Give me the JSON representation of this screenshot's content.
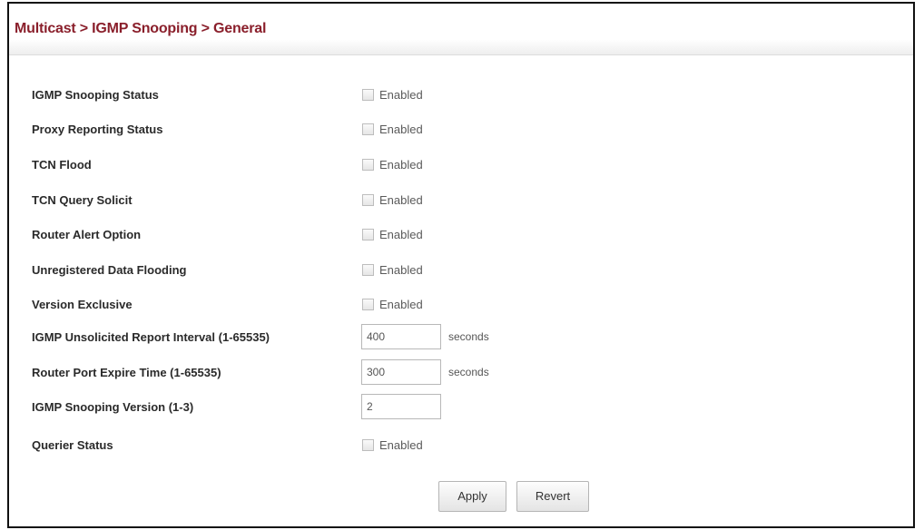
{
  "header": {
    "title": "Multicast > IGMP Snooping > General"
  },
  "form": {
    "rows": [
      {
        "label": "IGMP Snooping Status",
        "control": "checkbox",
        "checkbox_label": "Enabled",
        "checked": false
      },
      {
        "label": "Proxy Reporting Status",
        "control": "checkbox",
        "checkbox_label": "Enabled",
        "checked": false
      },
      {
        "label": "TCN Flood",
        "control": "checkbox",
        "checkbox_label": "Enabled",
        "checked": false
      },
      {
        "label": "TCN Query Solicit",
        "control": "checkbox",
        "checkbox_label": "Enabled",
        "checked": false
      },
      {
        "label": "Router Alert Option",
        "control": "checkbox",
        "checkbox_label": "Enabled",
        "checked": false
      },
      {
        "label": "Unregistered Data Flooding",
        "control": "checkbox",
        "checkbox_label": "Enabled",
        "checked": false
      },
      {
        "label": "Version Exclusive",
        "control": "checkbox",
        "checkbox_label": "Enabled",
        "checked": false
      },
      {
        "label": "IGMP Unsolicited Report Interval (1-65535)",
        "control": "input",
        "value": "400",
        "unit": "seconds"
      },
      {
        "label": "Router Port Expire Time (1-65535)",
        "control": "input",
        "value": "300",
        "unit": "seconds"
      },
      {
        "label": "IGMP Snooping Version (1-3)",
        "control": "input",
        "value": "2",
        "unit": ""
      },
      {
        "label": "Querier Status",
        "control": "checkbox",
        "checkbox_label": "Enabled",
        "checked": false
      }
    ]
  },
  "buttons": {
    "apply_label": "Apply",
    "revert_label": "Revert"
  },
  "colors": {
    "title": "#8a1f2b",
    "label": "#2a2a2a",
    "frame_border": "#111111"
  }
}
